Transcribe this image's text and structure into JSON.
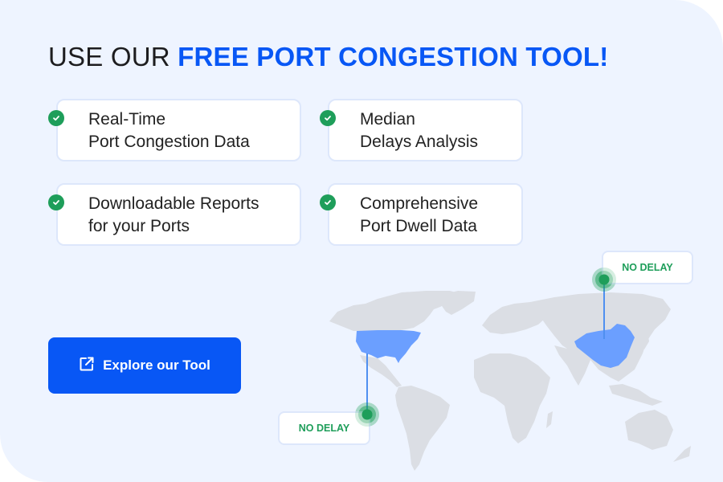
{
  "headline": {
    "prefix": "USE OUR ",
    "accent": "FREE PORT CONGESTION TOOL!"
  },
  "features": [
    {
      "icon": "check-circle-icon",
      "text": "Real-Time\nPort Congestion Data"
    },
    {
      "icon": "check-circle-icon",
      "text": "Median\nDelays Analysis"
    },
    {
      "icon": "check-circle-icon",
      "text": "Downloadable Reports\nfor your Ports"
    },
    {
      "icon": "check-circle-icon",
      "text": "Comprehensive\nPort Dwell Data"
    }
  ],
  "cta": {
    "icon": "external-link-icon",
    "label": "Explore our Tool"
  },
  "map": {
    "highlighted_regions": [
      "United States",
      "China"
    ],
    "markers": [
      {
        "region": "China",
        "status": "NO DELAY"
      },
      {
        "region": "United States",
        "status": "NO DELAY"
      }
    ]
  },
  "colors": {
    "background": "#eef4ff",
    "accent": "#0857f5",
    "status_ok": "#1e9e5a",
    "highlight": "#6b9fff",
    "land": "#dbdee4"
  }
}
